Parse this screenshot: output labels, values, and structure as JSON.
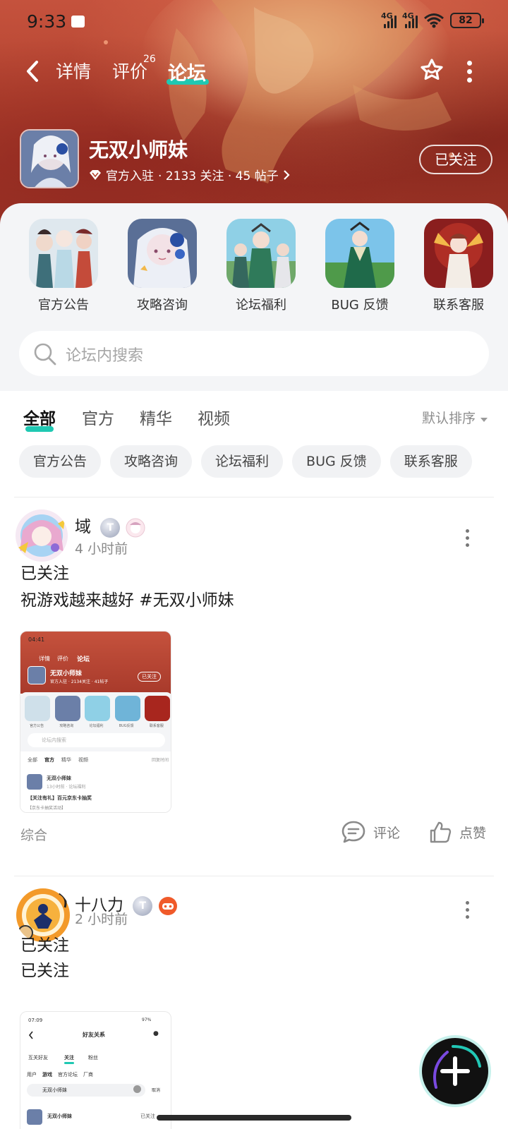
{
  "status": {
    "time": "9:33",
    "signal1": "4G",
    "signal2": "4G",
    "battery": "82"
  },
  "nav": {
    "tabs": [
      "详情",
      "评价",
      "论坛"
    ],
    "review_count": "26"
  },
  "forum": {
    "name": "无双小师妹",
    "meta_official": "官方入驻",
    "meta_follow": "· 2133 关注 · 45 帖子",
    "follow_label": "已关注"
  },
  "categories": [
    "官方公告",
    "攻略咨询",
    "论坛福利",
    "BUG 反馈",
    "联系客服"
  ],
  "search": {
    "placeholder": "论坛内搜索"
  },
  "filter_tabs": [
    "全部",
    "官方",
    "精华",
    "视频"
  ],
  "sort_label": "默认排序",
  "chips": [
    "官方公告",
    "攻略咨询",
    "论坛福利",
    "BUG 反馈",
    "联系客服"
  ],
  "posts": [
    {
      "author": "域",
      "time": "4 小时前",
      "lines": [
        "已关注",
        "祝游戏越来越好 #无双小师妹"
      ],
      "tag": "综合",
      "comment": "评论",
      "like": "点赞",
      "thumb": {
        "time": "04:41",
        "tabs": [
          "详情",
          "评价",
          "论坛"
        ],
        "name": "无双小师妹",
        "meta": "官方入驻 · 2134关注 · 41帖子",
        "follow": "已关注",
        "cats": [
          "官方公告",
          "攻略咨询",
          "论坛福利",
          "BUG反馈",
          "联系客服"
        ],
        "search": "论坛内搜索",
        "ftabs": [
          "全部",
          "官方",
          "精华",
          "视频"
        ],
        "sort": "回复时间",
        "post_name": "无双小师妹",
        "post_meta": "13小时前 · 论坛福利",
        "post_title": "【关注有礼】百元京东卡抽奖",
        "post_sub": "【京东卡抽奖活动】"
      }
    },
    {
      "author": "十八力",
      "time": "2 小时前",
      "lines": [
        "已关注",
        "已关注"
      ],
      "thumb": {
        "time": "07:09",
        "battery": "97%",
        "title": "好友关系",
        "tabs": [
          "互关好友",
          "关注",
          "粉丝"
        ],
        "subtabs": [
          "用户",
          "游戏",
          "官方论坛",
          "厂商"
        ],
        "search_value": "无双小师妹",
        "cancel": "取消",
        "result_name": "无双小师妹",
        "result_status": "已关注"
      }
    }
  ],
  "colors": {
    "accent": "#1fc8b2",
    "hero": "#b44430"
  }
}
